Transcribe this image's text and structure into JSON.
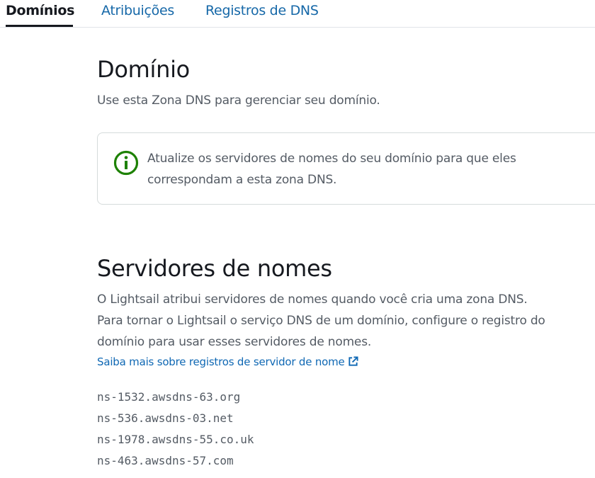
{
  "tabs": [
    {
      "label": "Domínios",
      "active": true
    },
    {
      "label": "Atribuições",
      "active": false
    },
    {
      "label": "Registros de DNS",
      "active": false
    }
  ],
  "domain": {
    "title": "Domínio",
    "description": "Use esta Zona DNS para gerenciar seu domínio."
  },
  "alert": {
    "icon": "info-circle-icon",
    "line1": "Atualize os servidores de nomes do seu domínio para que eles",
    "line2": "correspondam a esta zona DNS."
  },
  "nameservers": {
    "title": "Servidores de nomes",
    "description_line1": "O Lightsail atribui servidores de nomes quando você cria uma zona DNS.",
    "description_line2": "Para tornar o Lightsail o serviço DNS de um domínio, configure o registro do",
    "description_line3": "domínio para usar esses servidores de nomes.",
    "learn_more": "Saiba mais sobre registros de servidor de nome",
    "list": [
      "ns-1532.awsdns-63.org",
      "ns-536.awsdns-03.net",
      "ns-1978.awsdns-55.co.uk",
      "ns-463.awsdns-57.com"
    ]
  },
  "colors": {
    "link": "#0f68b4",
    "success_green": "#1d8102",
    "text": "#16191f",
    "secondary_text": "#545b64"
  }
}
